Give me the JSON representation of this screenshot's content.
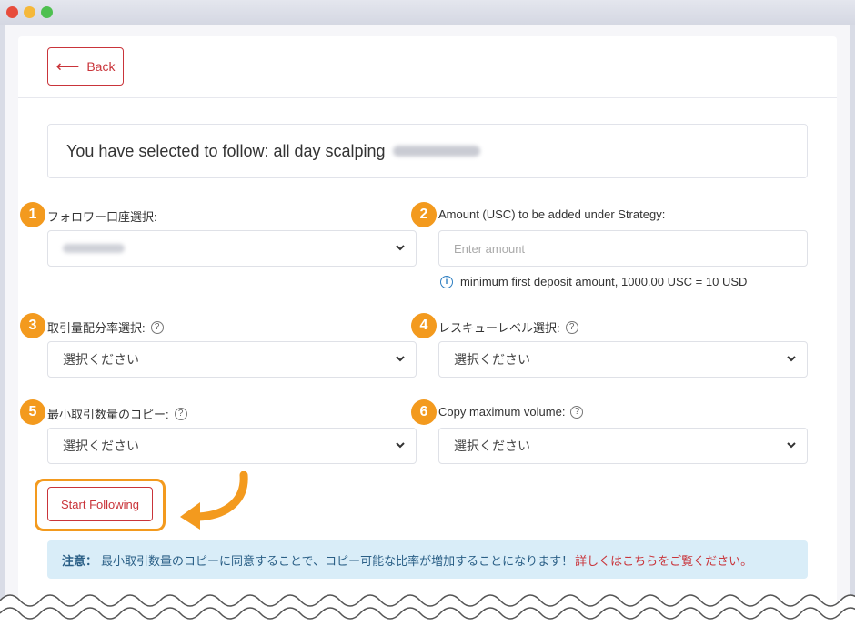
{
  "window": {
    "controls": [
      "close",
      "minimize",
      "maximize"
    ]
  },
  "back": {
    "label": "Back",
    "icon": "left-arrow-icon"
  },
  "selection": {
    "text": "You have selected to follow: all day scalping"
  },
  "fields": {
    "f1": {
      "step": "1",
      "label": "フォロワー口座選択:"
    },
    "f2": {
      "step": "2",
      "label": "Amount (USC) to be added under Strategy:",
      "placeholder": "Enter amount",
      "note": "minimum first deposit amount, 1000.00 USC = 10 USD"
    },
    "f3": {
      "step": "3",
      "label": "取引量配分率選択:",
      "value": "選択ください"
    },
    "f4": {
      "step": "4",
      "label": "レスキューレベル選択:",
      "value": "選択ください"
    },
    "f5": {
      "step": "5",
      "label": "最小取引数量のコピー:",
      "value": "選択ください"
    },
    "f6": {
      "step": "6",
      "label": "Copy maximum volume:",
      "value": "選択ください"
    }
  },
  "start": {
    "label": "Start Following"
  },
  "notice": {
    "prefix": "注意：",
    "text": "最小取引数量のコピーに同意することで、コピー可能な比率が増加することになります！",
    "link": "詳しくはこちらをご覧ください。"
  },
  "colors": {
    "accent": "#c9343a",
    "badge": "#f39a1e",
    "notice_bg": "#d9edf8",
    "info": "#2f7fc1"
  }
}
